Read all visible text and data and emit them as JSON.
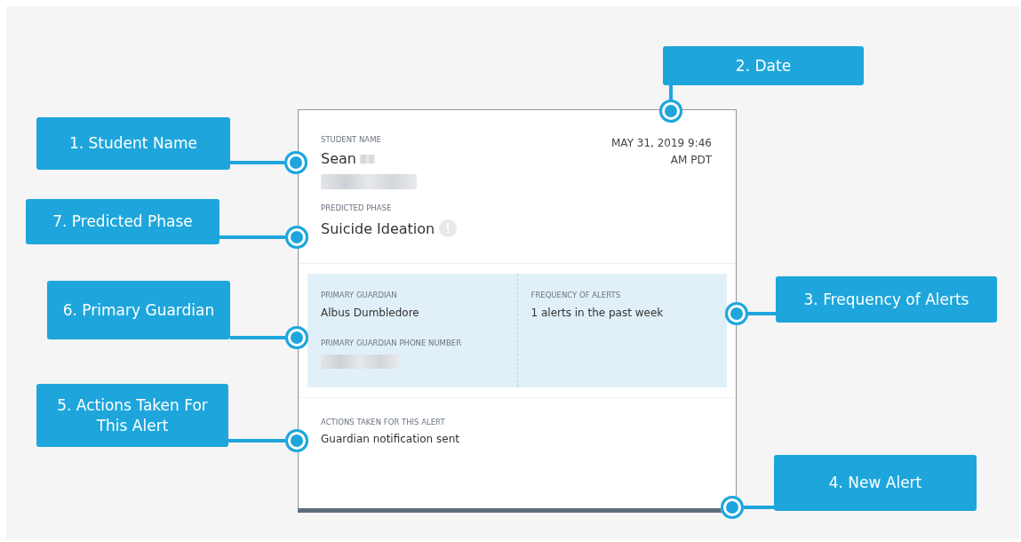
{
  "card": {
    "student_name_label": "STUDENT NAME",
    "student_name": "Sean",
    "date": "MAY 31, 2019 9:46 AM PDT",
    "predicted_phase_label": "PREDICTED PHASE",
    "predicted_phase": "Suicide Ideation",
    "guardian_label": "PRIMARY GUARDIAN",
    "guardian": "Albus Dumbledore",
    "guardian_phone_label": "PRIMARY GUARDIAN PHONE NUMBER",
    "frequency_label": "FREQUENCY OF ALERTS",
    "frequency": "1 alerts in the past week",
    "actions_label": "ACTIONS TAKEN FOR THIS ALERT",
    "actions": "Guardian notification sent"
  },
  "callouts": [
    {
      "label": "2. Date"
    },
    {
      "label": "1. Student Name"
    },
    {
      "label": "7. Predicted Phase"
    },
    {
      "label": "3. Frequency of Alerts"
    },
    {
      "label": "6. Primary Guardian"
    },
    {
      "label": "5. Actions Taken For This Alert"
    },
    {
      "label": "4. New Alert"
    }
  ]
}
